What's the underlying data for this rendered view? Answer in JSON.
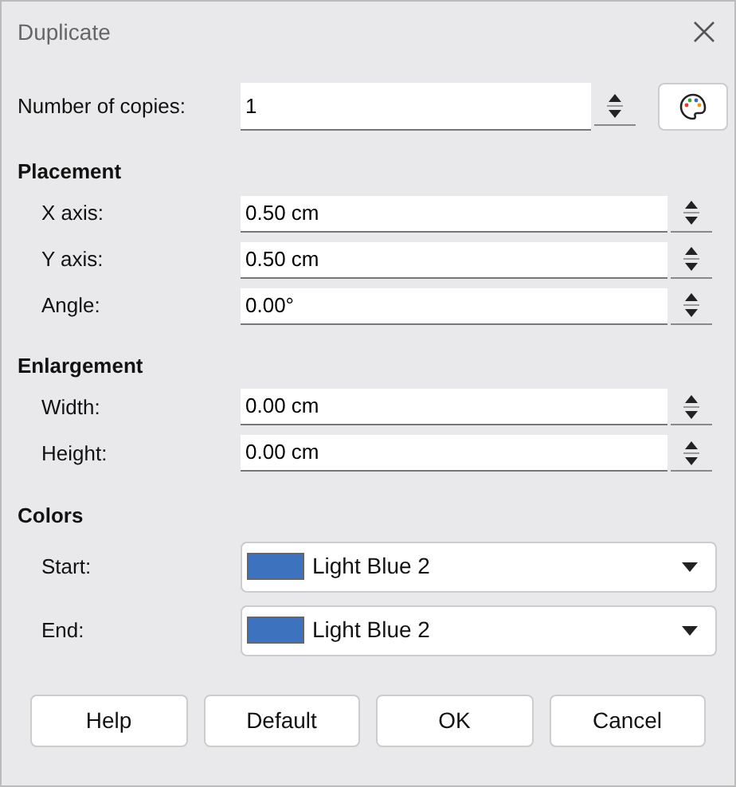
{
  "window": {
    "title": "Duplicate"
  },
  "copies": {
    "label": "Number of copies:",
    "value": "1"
  },
  "sections": [
    {
      "heading": "Placement",
      "fields": [
        {
          "label": "X axis:",
          "value": "0.50 cm"
        },
        {
          "label": "Y axis:",
          "value": "0.50 cm"
        },
        {
          "label": "Angle:",
          "value": "0.00°"
        }
      ]
    },
    {
      "heading": "Enlargement",
      "fields": [
        {
          "label": "Width:",
          "value": "0.00 cm"
        },
        {
          "label": "Height:",
          "value": "0.00 cm"
        }
      ]
    }
  ],
  "colors": {
    "heading": "Colors",
    "items": [
      {
        "label": "Start:",
        "value": "Light Blue 2",
        "color": "#3d72be"
      },
      {
        "label": "End:",
        "value": "Light Blue 2",
        "color": "#3d72be"
      }
    ]
  },
  "buttons": [
    "Help",
    "Default",
    "OK",
    "Cancel"
  ]
}
